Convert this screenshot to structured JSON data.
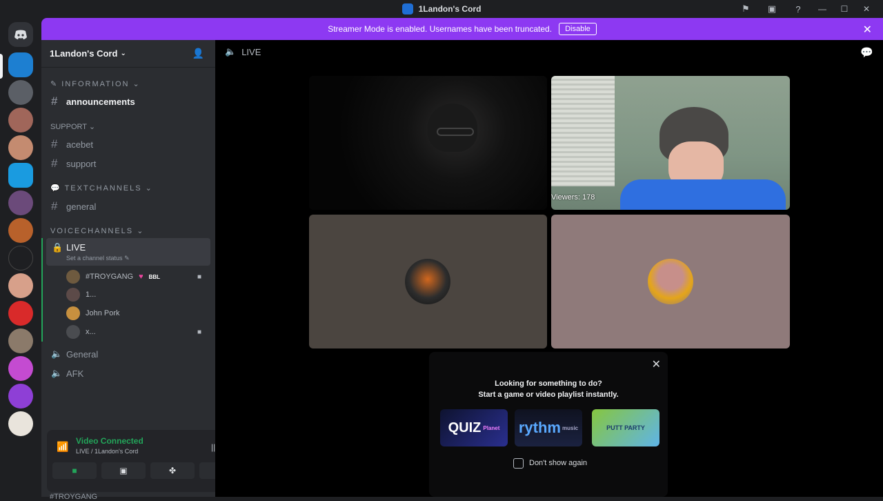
{
  "window": {
    "title": "1Landon's Cord",
    "icons": [
      "flag-icon",
      "screen-share-icon",
      "help-icon"
    ],
    "controls": [
      "—",
      "☐",
      "✕"
    ]
  },
  "banner": {
    "text": "Streamer Mode is enabled. Usernames have been truncated.",
    "button": "Disable"
  },
  "sidebar": {
    "server_name": "1Landon's Cord",
    "categories": [
      {
        "label": "INFORMATION"
      },
      {
        "label": "SUPPORT"
      },
      {
        "label": "TEXTCHANNELS"
      },
      {
        "label": "VOICECHANNELS"
      }
    ],
    "channels": {
      "announcements": "announcements",
      "acebet": "acebet",
      "support": "support",
      "general": "general"
    },
    "voice": {
      "live": "LIVE",
      "live_status": "Set a channel status",
      "general": "General",
      "afk": "AFK",
      "members": [
        {
          "name": "#TROYGANG",
          "badge": "BBL"
        },
        {
          "name": "1..."
        },
        {
          "name": "John Pork"
        },
        {
          "name": "x..."
        }
      ]
    }
  },
  "voice_panel": {
    "title": "Video Connected",
    "subtitle": "LIVE / 1Landon's Cord",
    "footer_user": "#TROYGANG"
  },
  "main": {
    "channel": "LIVE",
    "viewers": "Viewers: 178"
  },
  "activity_popup": {
    "line1": "Looking for something to do?",
    "line2": "Start a game or video playlist instantly.",
    "cards": [
      {
        "title": "QUIZ",
        "sub": "Planet"
      },
      {
        "title": "rythm",
        "sub": "music"
      },
      {
        "title": "PUTT PARTY",
        "sub": ""
      }
    ],
    "checkbox_label": "Don't show again"
  },
  "colors": {
    "accent": "#8d39f2",
    "connected": "#23a55a",
    "sidebar": "#2b2d31",
    "rail": "#1e1f22"
  }
}
